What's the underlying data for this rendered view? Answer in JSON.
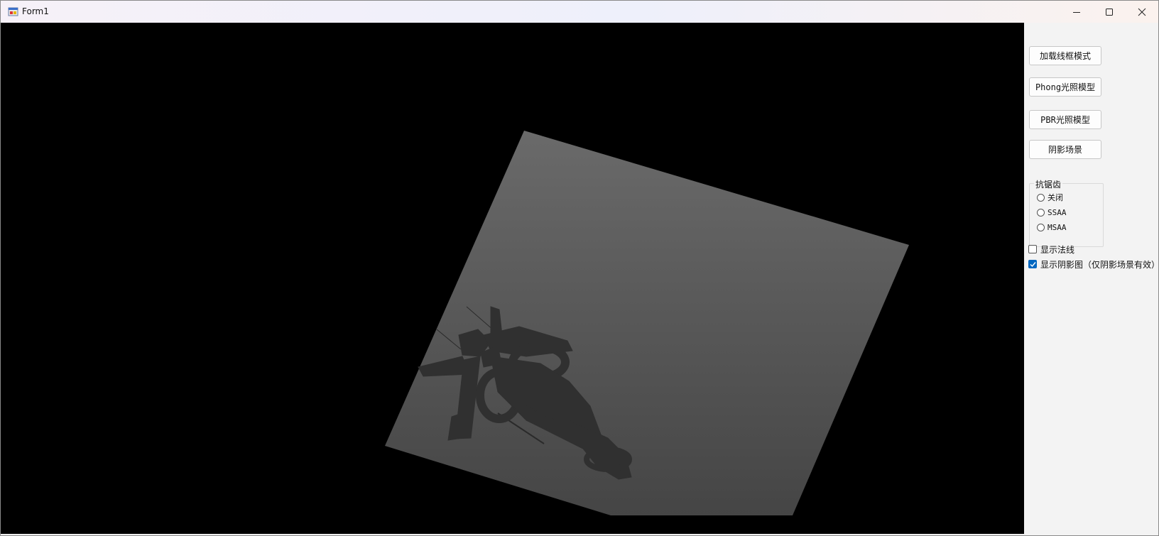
{
  "window": {
    "title": "Form1",
    "minimize_icon": "minimize-icon",
    "maximize_icon": "maximize-icon",
    "close_icon": "close-icon"
  },
  "viewport": {
    "description_icon": "shadow-map-render",
    "scene": "shadow-map"
  },
  "panel": {
    "buttons": {
      "wireframe": "加载线框模式",
      "phong": "Phong光照模型",
      "pbr": "PBR光照模型",
      "shadow": "阴影场景"
    },
    "antialias": {
      "legend": "抗锯齿",
      "options": [
        "关闭",
        "SSAA",
        "MSAA"
      ],
      "selected": null
    },
    "checkboxes": {
      "show_normals": {
        "label": "显示法线",
        "checked": false
      },
      "show_shadow_map": {
        "label": "显示阴影图（仅阴影场景有效）",
        "checked": true
      }
    }
  },
  "colors": {
    "accent": "#0067c0",
    "viewport_bg": "#000000",
    "plane_top": "#6a6a6a",
    "plane_bottom": "#454545",
    "silhouette": "#303030"
  }
}
